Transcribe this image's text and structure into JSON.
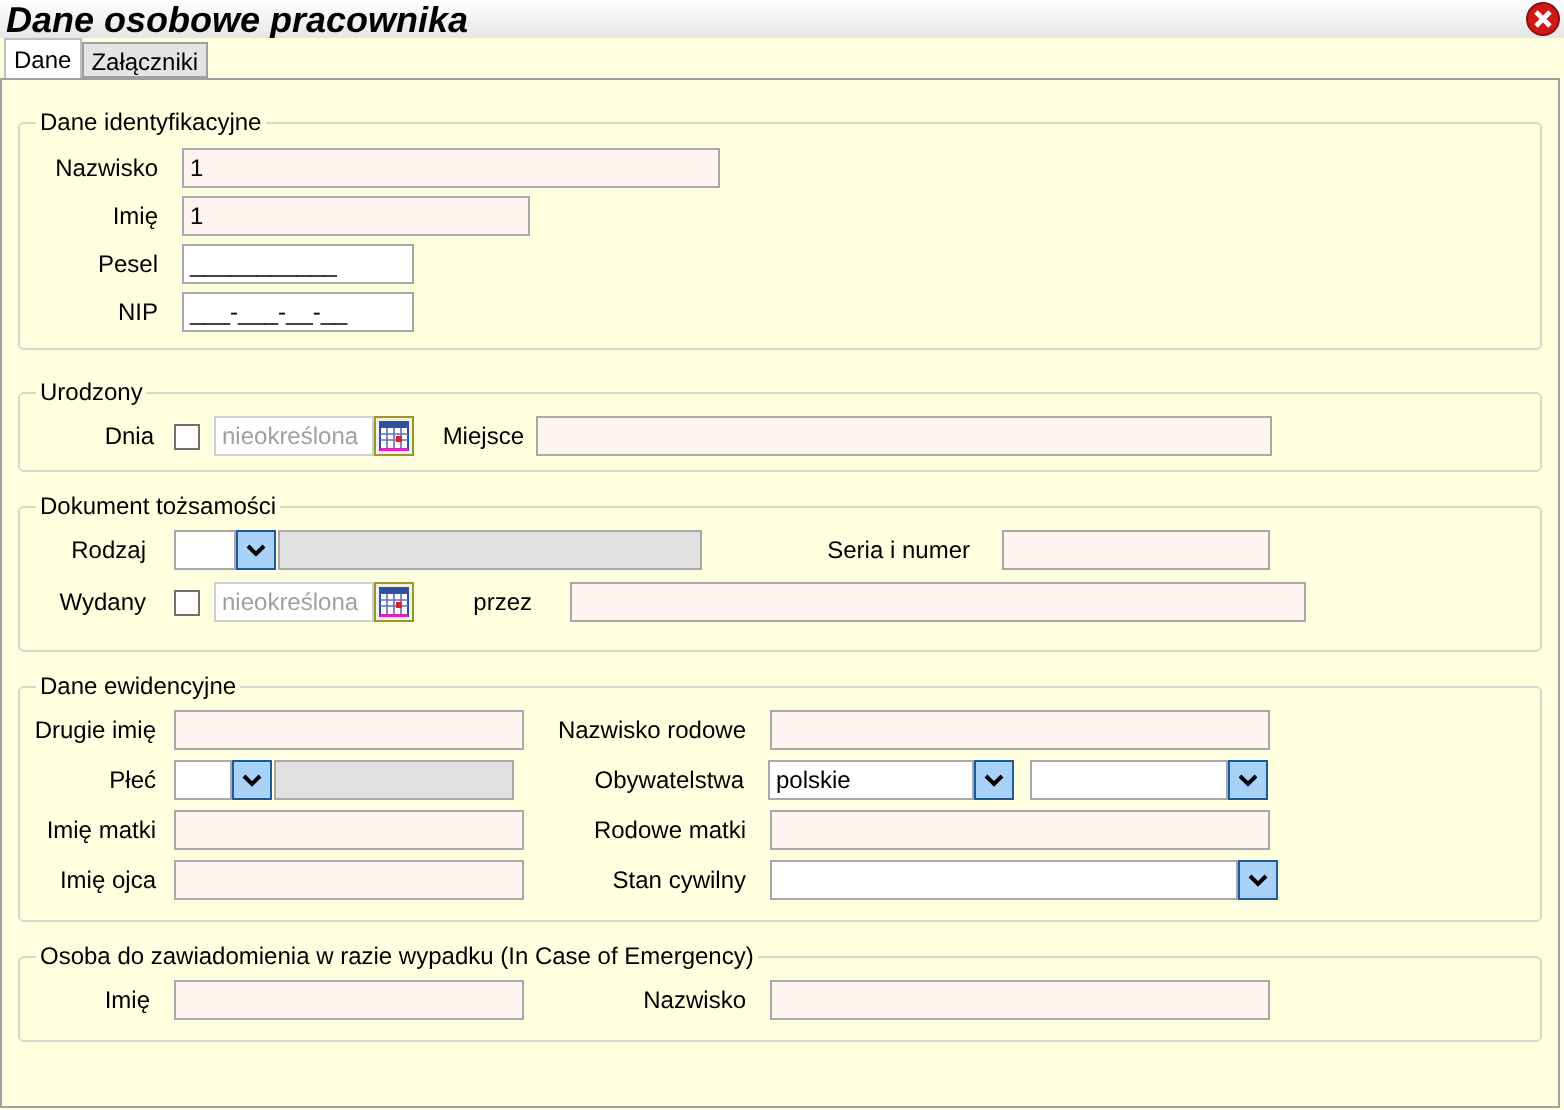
{
  "window": {
    "title": "Dane osobowe pracownika"
  },
  "tabs": [
    {
      "label": "Dane",
      "selected": true
    },
    {
      "label": "Załączniki",
      "selected": false
    }
  ],
  "identification": {
    "legend": "Dane identyfikacyjne",
    "surname": {
      "label": "Nazwisko",
      "value": "1"
    },
    "first_name": {
      "label": "Imię",
      "value": "1"
    },
    "pesel": {
      "label": "Pesel",
      "value": "___________"
    },
    "nip": {
      "label": "NIP",
      "value": "___-___-__-__"
    }
  },
  "birth": {
    "legend": "Urodzony",
    "date": {
      "label": "Dnia",
      "checked": false,
      "value": "nieokreślona"
    },
    "place": {
      "label": "Miejsce"
    }
  },
  "id_document": {
    "legend": "Dokument tożsamości",
    "type": {
      "label": "Rodzaj"
    },
    "series_number": {
      "label": "Seria i numer"
    },
    "issued": {
      "label": "Wydany",
      "checked": false,
      "value": "nieokreślona"
    },
    "issued_by": {
      "label": "przez"
    }
  },
  "records": {
    "legend": "Dane ewidencyjne",
    "second_name": {
      "label": "Drugie imię"
    },
    "maiden_name": {
      "label": "Nazwisko rodowe"
    },
    "sex": {
      "label": "Płeć"
    },
    "citizenship": {
      "label": "Obywatelstwa",
      "value": "polskie"
    },
    "mother_name": {
      "label": "Imię matki"
    },
    "mother_maiden_name": {
      "label": "Rodowe matki"
    },
    "father_name": {
      "label": "Imię ojca"
    },
    "marital_status": {
      "label": "Stan cywilny"
    }
  },
  "emergency": {
    "legend": "Osoba do zawiadomienia w razie wypadku (In Case of Emergency)",
    "first_name": {
      "label": "Imię"
    },
    "surname": {
      "label": "Nazwisko"
    }
  }
}
